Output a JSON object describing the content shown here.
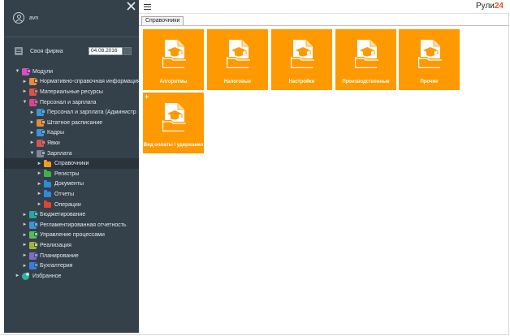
{
  "user": {
    "name": "avn"
  },
  "firm": {
    "label": "Своя фирма",
    "date": "04.08.2016"
  },
  "tree": [
    {
      "label": "Модули",
      "level": 0,
      "expanded": true,
      "icon": "modules-icon",
      "color": "#d94fc0",
      "kind": "box"
    },
    {
      "label": "Нормативно-справочная информация",
      "level": 1,
      "expanded": false,
      "icon": "reference-icon",
      "color": "#e88a3a",
      "kind": "box"
    },
    {
      "label": "Материальные ресурсы",
      "level": 1,
      "expanded": false,
      "icon": "materials-icon",
      "color": "#d9534f",
      "kind": "box"
    },
    {
      "label": "Персонал и зарплата",
      "level": 1,
      "expanded": true,
      "icon": "personnel-icon",
      "color": "#d9458a",
      "kind": "box"
    },
    {
      "label": "Персонал и зарплата (Администр",
      "level": 2,
      "expanded": false,
      "icon": "personnel-admin-icon",
      "color": "#3a96d6",
      "kind": "box"
    },
    {
      "label": "Штатное расписание",
      "level": 2,
      "expanded": false,
      "icon": "staffing-icon",
      "color": "#e88a3a",
      "kind": "box"
    },
    {
      "label": "Кадры",
      "level": 2,
      "expanded": false,
      "icon": "hr-icon",
      "color": "#3a96d6",
      "kind": "box"
    },
    {
      "label": "Явки",
      "level": 2,
      "expanded": false,
      "icon": "attendance-icon",
      "color": "#d9534f",
      "kind": "box"
    },
    {
      "label": "Зарплата",
      "level": 2,
      "expanded": true,
      "icon": "salary-icon",
      "color": "#7b8a96",
      "kind": "box"
    },
    {
      "label": "Справочники",
      "level": 3,
      "expanded": false,
      "icon": "folder-icon",
      "color": "#f29b1d",
      "kind": "folder",
      "selected": true
    },
    {
      "label": "Регистры",
      "level": 3,
      "expanded": false,
      "icon": "folder-icon",
      "color": "#3bb54a",
      "kind": "folder"
    },
    {
      "label": "Документы",
      "level": 3,
      "expanded": false,
      "icon": "folder-icon",
      "color": "#2f8ad8",
      "kind": "folder"
    },
    {
      "label": "Отчеты",
      "level": 3,
      "expanded": false,
      "icon": "folder-icon",
      "color": "#2f8ad8",
      "kind": "folder"
    },
    {
      "label": "Операции",
      "level": 3,
      "expanded": false,
      "icon": "folder-icon",
      "color": "#e0462f",
      "kind": "folder"
    },
    {
      "label": "Бюджетирование",
      "level": 1,
      "expanded": false,
      "icon": "budget-icon",
      "color": "#2aa6a0",
      "kind": "box"
    },
    {
      "label": "Регламентированная отчетность",
      "level": 1,
      "expanded": false,
      "icon": "reporting-icon",
      "color": "#3a96d6",
      "kind": "box"
    },
    {
      "label": "Управление процессами",
      "level": 1,
      "expanded": false,
      "icon": "process-icon",
      "color": "#5cb85c",
      "kind": "box"
    },
    {
      "label": "Реализация",
      "level": 1,
      "expanded": false,
      "icon": "sales-icon",
      "color": "#a3b23a",
      "kind": "box"
    },
    {
      "label": "Планирование",
      "level": 1,
      "expanded": false,
      "icon": "planning-icon",
      "color": "#7b6fc2",
      "kind": "box"
    },
    {
      "label": "Бухгалтерия",
      "level": 1,
      "expanded": false,
      "icon": "accounting-icon",
      "color": "#3a7fd6",
      "kind": "box"
    },
    {
      "label": "Избранное",
      "level": 0,
      "expanded": false,
      "icon": "favorites-icon",
      "color": "#2bb3a3",
      "kind": "star"
    }
  ],
  "brand": {
    "text": "Рули",
    "accent": "24",
    "accent_color": "#e3541b"
  },
  "tabs": [
    {
      "label": "Справочники"
    }
  ],
  "tiles": [
    {
      "label": "Алгоритмы"
    },
    {
      "label": "Налоговые"
    },
    {
      "label": "Настройки"
    },
    {
      "label": "Производственные"
    },
    {
      "label": "Прочие"
    },
    {
      "label": "Вид оплаты / удержания",
      "plus": "+"
    }
  ],
  "colors": {
    "sidebar": "#34404a",
    "tile": "#ff9900"
  }
}
